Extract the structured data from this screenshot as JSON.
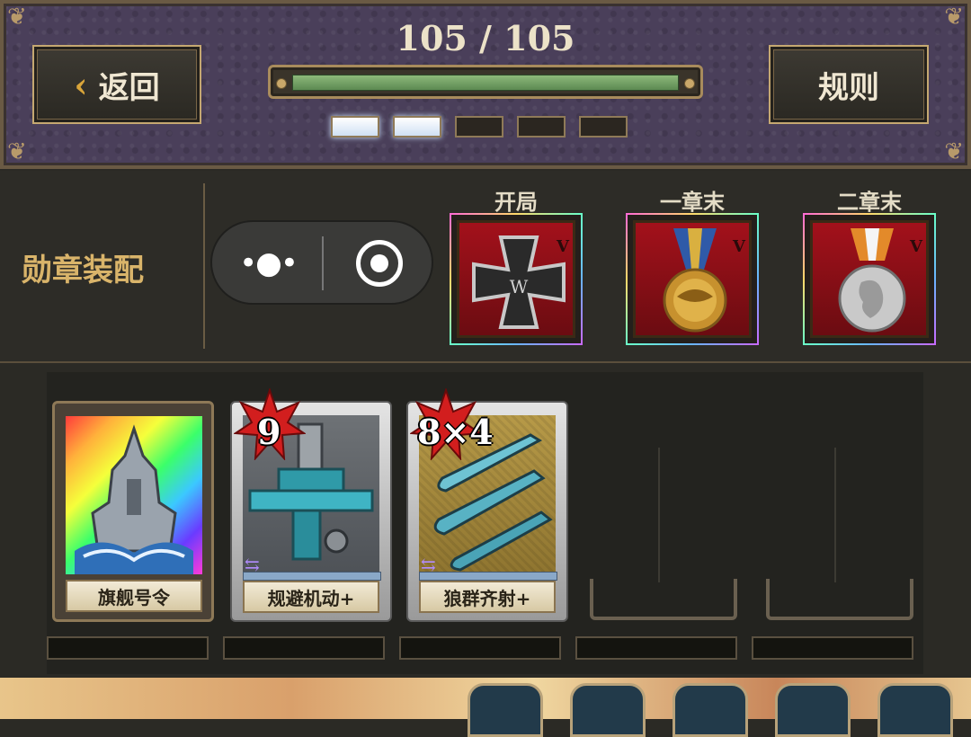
{
  "header": {
    "counter": "105 / 105",
    "progress": 1.0,
    "back_label": "返回",
    "rules_label": "规则",
    "pips": [
      true,
      true,
      false,
      false,
      false
    ]
  },
  "medals": {
    "title": "勋章装配",
    "slots": [
      {
        "label": "开局",
        "icon": "iron-cross-medal-icon",
        "mark": "V"
      },
      {
        "label": "一章末",
        "icon": "eagle-medal-icon",
        "mark": "V"
      },
      {
        "label": "二章末",
        "icon": "silver-portrait-medal-icon",
        "mark": "V"
      }
    ]
  },
  "cards": [
    {
      "name": "旗舰号令",
      "icon": "battleship-icon",
      "cost": ""
    },
    {
      "name": "规避机动+",
      "icon": "engine-machinery-icon",
      "cost": "9"
    },
    {
      "name": "狼群齐射+",
      "icon": "torpedo-icon",
      "cost": "8×4"
    }
  ],
  "colors": {
    "header_bg": "#4a3f5a",
    "accent_gold": "#d9b46a",
    "progress_green": "#6a9a5c"
  }
}
